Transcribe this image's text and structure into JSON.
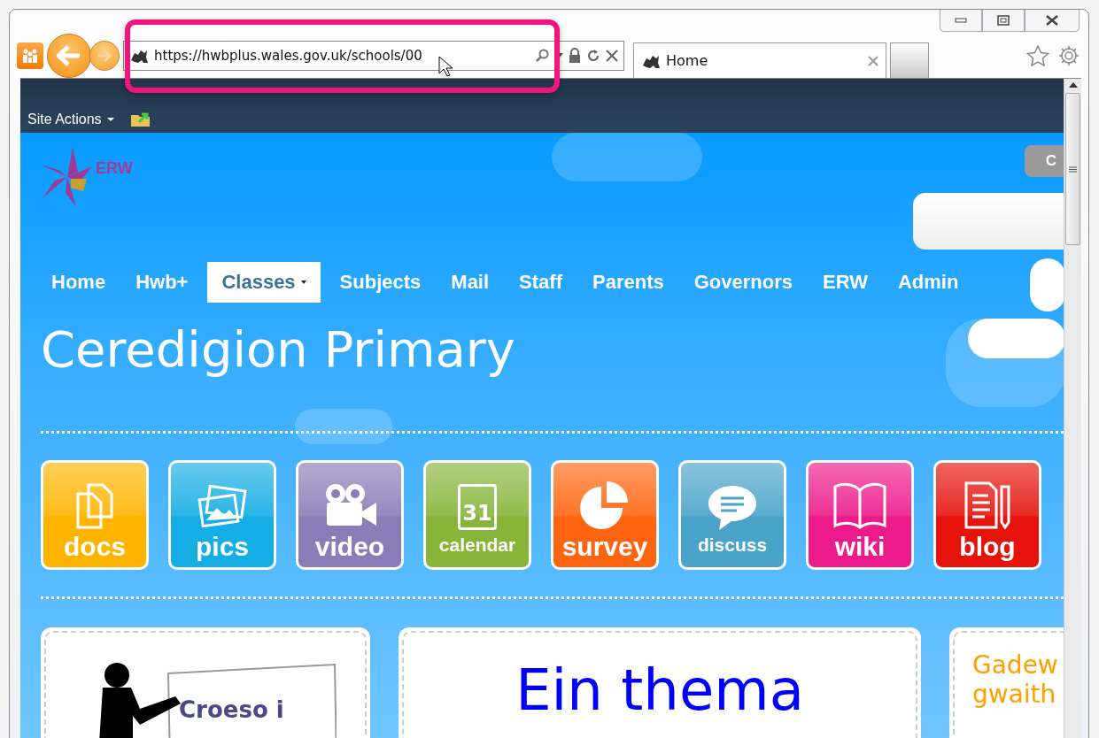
{
  "browser": {
    "address": "https://hwbplus.wales.gov.uk/schools/00",
    "tab": {
      "label": "Home",
      "selected": true
    }
  },
  "ribbon": {
    "site_actions": "Site Actions"
  },
  "header": {
    "logo_text": "ERW",
    "button_label": "C"
  },
  "nav": [
    {
      "label": "Home",
      "selected": false,
      "dropdown": false
    },
    {
      "label": "Hwb+",
      "selected": false,
      "dropdown": false
    },
    {
      "label": "Classes",
      "selected": true,
      "dropdown": true
    },
    {
      "label": "Subjects",
      "selected": false,
      "dropdown": false
    },
    {
      "label": "Mail",
      "selected": false,
      "dropdown": false
    },
    {
      "label": "Staff",
      "selected": false,
      "dropdown": false
    },
    {
      "label": "Parents",
      "selected": false,
      "dropdown": false
    },
    {
      "label": "Governors",
      "selected": false,
      "dropdown": false
    },
    {
      "label": "ERW",
      "selected": false,
      "dropdown": false
    },
    {
      "label": "Admin",
      "selected": false,
      "dropdown": false
    }
  ],
  "title": "Ceredigion Primary",
  "tiles": [
    {
      "label": "docs",
      "kind": "docs",
      "color": "#ffb400"
    },
    {
      "label": "pics",
      "kind": "pics",
      "color": "#14ade4"
    },
    {
      "label": "video",
      "kind": "video",
      "color": "#8a7cb6"
    },
    {
      "label": "calendar",
      "kind": "calendar",
      "color": "#86b53a",
      "icon_text": "31"
    },
    {
      "label": "survey",
      "kind": "survey",
      "color": "#ff6510"
    },
    {
      "label": "discuss",
      "kind": "discuss",
      "color": "#4aa3c9"
    },
    {
      "label": "wiki",
      "kind": "wiki",
      "color": "#ec1a8a"
    },
    {
      "label": "blog",
      "kind": "blog",
      "color": "#e5130c"
    }
  ],
  "cards": [
    {
      "kind": "picture",
      "caption": "Croeso i"
    },
    {
      "kind": "heading",
      "text": "Ein thema"
    },
    {
      "kind": "lines",
      "lines": [
        "Gadew",
        "gwaith"
      ]
    }
  ]
}
